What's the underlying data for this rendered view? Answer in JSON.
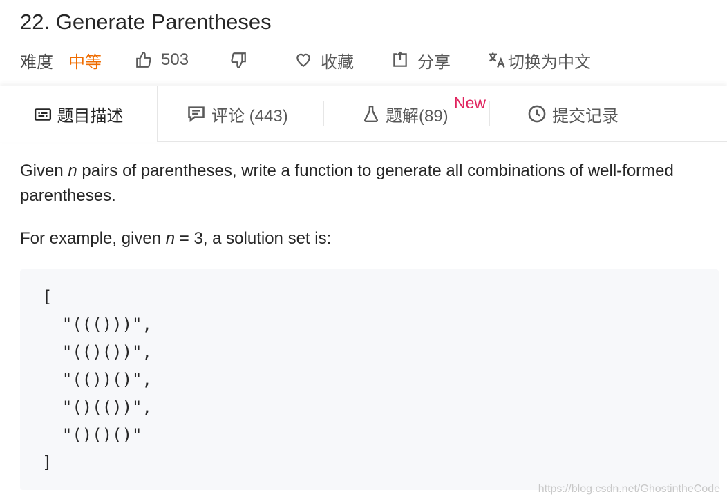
{
  "problem": {
    "title": "22. Generate Parentheses",
    "difficulty_label": "难度",
    "difficulty_value": "中等",
    "likes": "503",
    "favorite_label": "收藏",
    "share_label": "分享",
    "translate_label": "切换为中文"
  },
  "tabs": [
    {
      "label": "题目描述"
    },
    {
      "label": "评论 (443)"
    },
    {
      "label": "题解(89)",
      "badge": "New"
    },
    {
      "label": "提交记录"
    }
  ],
  "description": {
    "p1_before": "Given ",
    "p1_var": "n",
    "p1_after": " pairs of parentheses, write a function to generate all combinations of well-formed parentheses.",
    "p2_before": "For example, given ",
    "p2_var": "n",
    "p2_after": " = 3, a solution set is:",
    "code": "[\n  \"((()))\",\n  \"(()())\",\n  \"(())()\",\n  \"()(())\",\n  \"()()()\"\n]"
  },
  "watermark": "https://blog.csdn.net/GhostintheCode",
  "colors": {
    "difficulty": "#ef6c00",
    "new_badge": "#e0245e"
  }
}
